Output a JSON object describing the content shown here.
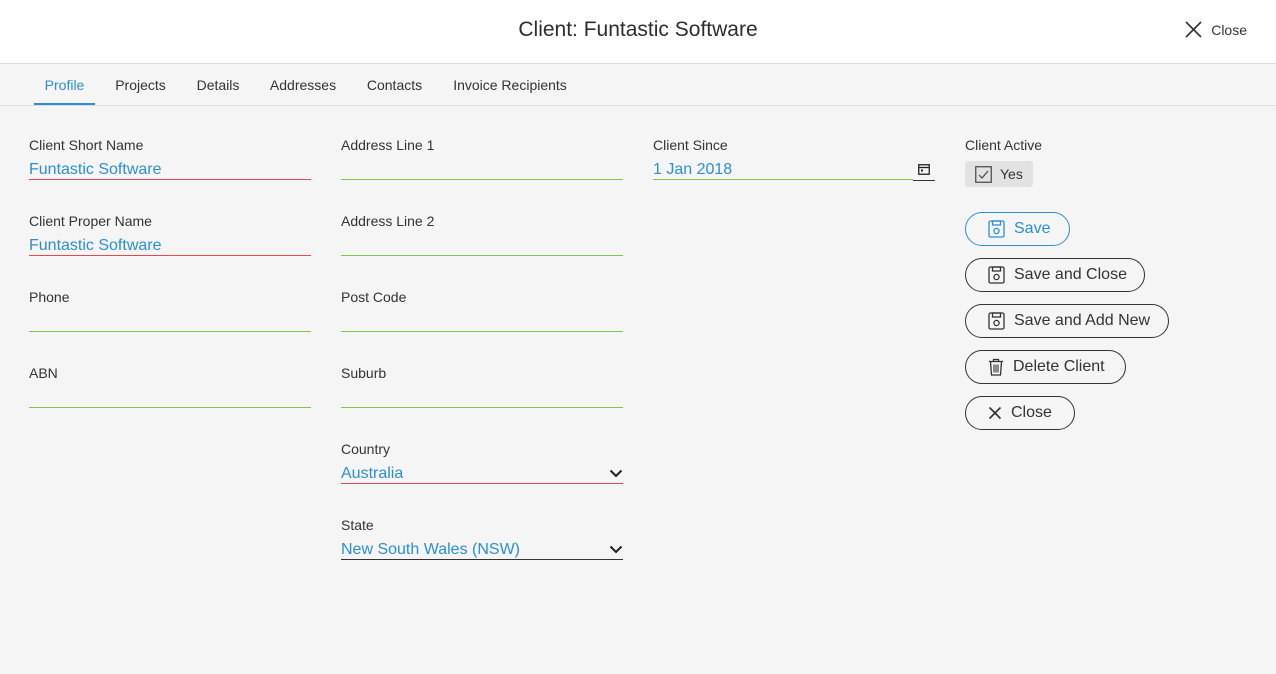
{
  "header": {
    "title": "Client: Funtastic Software",
    "close_label": "Close"
  },
  "tabs": [
    {
      "label": "Profile",
      "active": true
    },
    {
      "label": "Projects"
    },
    {
      "label": "Details"
    },
    {
      "label": "Addresses"
    },
    {
      "label": "Contacts"
    },
    {
      "label": "Invoice Recipients"
    }
  ],
  "form": {
    "client_short_name": {
      "label": "Client Short Name",
      "value": "Funtastic Software"
    },
    "client_proper_name": {
      "label": "Client Proper Name",
      "value": "Funtastic Software"
    },
    "phone": {
      "label": "Phone",
      "value": ""
    },
    "abn": {
      "label": "ABN",
      "value": ""
    },
    "address_line_1": {
      "label": "Address Line 1",
      "value": ""
    },
    "address_line_2": {
      "label": "Address Line 2",
      "value": ""
    },
    "post_code": {
      "label": "Post Code",
      "value": ""
    },
    "suburb": {
      "label": "Suburb",
      "value": ""
    },
    "country": {
      "label": "Country",
      "value": "Australia"
    },
    "state": {
      "label": "State",
      "value": "New South Wales (NSW)"
    },
    "client_since": {
      "label": "Client Since",
      "value": "1 Jan 2018"
    },
    "client_active": {
      "label": "Client Active",
      "value": "Yes",
      "checked": true
    }
  },
  "actions": {
    "save": "Save",
    "save_and_close": "Save and Close",
    "save_and_add_new": "Save and Add New",
    "delete_client": "Delete Client",
    "close": "Close"
  },
  "colors": {
    "accent": "#2c8fd3",
    "valid_underline": "#7cc846",
    "required_underline": "#e34a4a"
  }
}
